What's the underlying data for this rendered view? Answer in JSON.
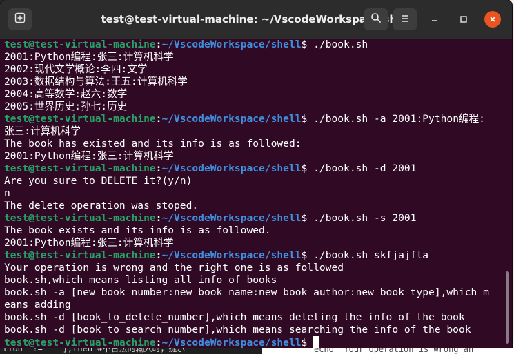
{
  "window": {
    "title": "test@test-virtual-machine: ~/VscodeWorkspace/shell"
  },
  "prompt": {
    "user": "test@test-virtual-machine",
    "separator": ":",
    "path": "~/VscodeWorkspace/shell",
    "symbol": "$ "
  },
  "terminal": {
    "lines": [
      {
        "type": "prompt",
        "cmd": "./book.sh"
      },
      {
        "type": "out",
        "text": "2001:Python编程:张三:计算机科学"
      },
      {
        "type": "out",
        "text": "2002:现代文学概论:李四:文学"
      },
      {
        "type": "out",
        "text": "2003:数据结构与算法:王五:计算机科学"
      },
      {
        "type": "out",
        "text": "2004:高等数学:赵六:数学"
      },
      {
        "type": "out",
        "text": "2005:世界历史:孙七:历史"
      },
      {
        "type": "prompt",
        "cmd": "./book.sh -a 2001:Python编程:"
      },
      {
        "type": "out",
        "text": "张三:计算机科学"
      },
      {
        "type": "out",
        "text": "The book has existed and its info is as followed:"
      },
      {
        "type": "out",
        "text": "2001:Python编程:张三:计算机科学"
      },
      {
        "type": "prompt",
        "cmd": "./book.sh -d 2001"
      },
      {
        "type": "out",
        "text": "Are you sure to DELETE it?(y/n)"
      },
      {
        "type": "out",
        "text": "n"
      },
      {
        "type": "out",
        "text": "The delete operation was stoped."
      },
      {
        "type": "prompt",
        "cmd": "./book.sh -s 2001"
      },
      {
        "type": "out",
        "text": "The book exists and its info is as followed."
      },
      {
        "type": "out",
        "text": "2001:Python编程:张三:计算机科学"
      },
      {
        "type": "prompt",
        "cmd": "./book.sh skfjajfla"
      },
      {
        "type": "out",
        "text": "Your operation is wrong and the right one is as followed"
      },
      {
        "type": "out",
        "text": "book.sh,which means listing all info of books"
      },
      {
        "type": "out",
        "text": "book.sh -a [new_book_number:new_book_name:new_book_author:new_book_type],which m"
      },
      {
        "type": "out",
        "text": "eans adding"
      },
      {
        "type": "out",
        "text": "book.sh -d [book_to_delete_number],which means deleting the info of the book"
      },
      {
        "type": "out",
        "text": "book.sh -d [book_to_search_number],which means searching the info of the book"
      },
      {
        "type": "prompt",
        "cmd": "",
        "cursor": true
      }
    ]
  },
  "background": {
    "left_snippet": "tion\" != \"\" ];then #不合法的输入时，提示",
    "right_snippet": "echo \"Your operation is wrong an"
  },
  "colors": {
    "terminal_bg": "#300a24",
    "titlebar_bg": "#2c2c2c",
    "prompt_user": "#26a269",
    "prompt_path": "#3f8fe0",
    "close_button": "#e95420"
  },
  "icons": {
    "new_tab": "new-tab-icon",
    "search": "search-icon",
    "menu": "hamburger-menu-icon",
    "minimize": "minimize-icon",
    "maximize": "maximize-icon",
    "close": "close-icon"
  }
}
